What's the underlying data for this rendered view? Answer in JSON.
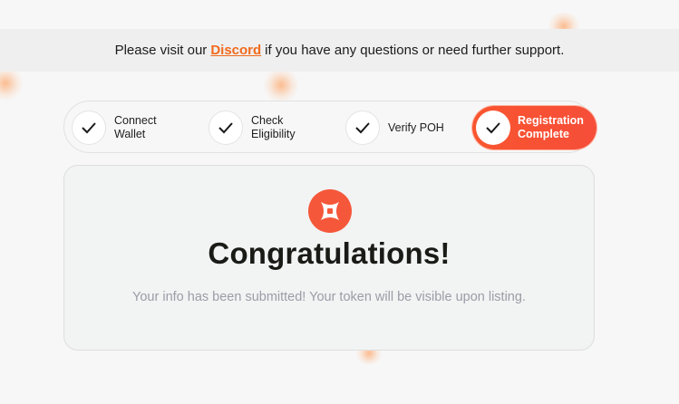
{
  "banner": {
    "prefix": "Please visit our",
    "link": "Discord",
    "suffix": "if you have any questions or need further support."
  },
  "steps": [
    {
      "label": "Connect\nWallet",
      "done": true,
      "active": false,
      "icon": "check-icon"
    },
    {
      "label": "Check\nEligibility",
      "done": true,
      "active": false,
      "icon": "check-icon"
    },
    {
      "label": "Verify POH",
      "done": true,
      "active": false,
      "icon": "check-icon"
    },
    {
      "label": "Registration\nComplete",
      "done": true,
      "active": true,
      "icon": "check-icon"
    }
  ],
  "card": {
    "badge_icon": "brand-logo-icon",
    "title": "Congratulations!",
    "message": "Your info has been submitted! Your token will be visible upon listing."
  },
  "colors": {
    "accent": "#f5573a",
    "link": "#f06a1d",
    "muted_text": "#9a9da6"
  }
}
